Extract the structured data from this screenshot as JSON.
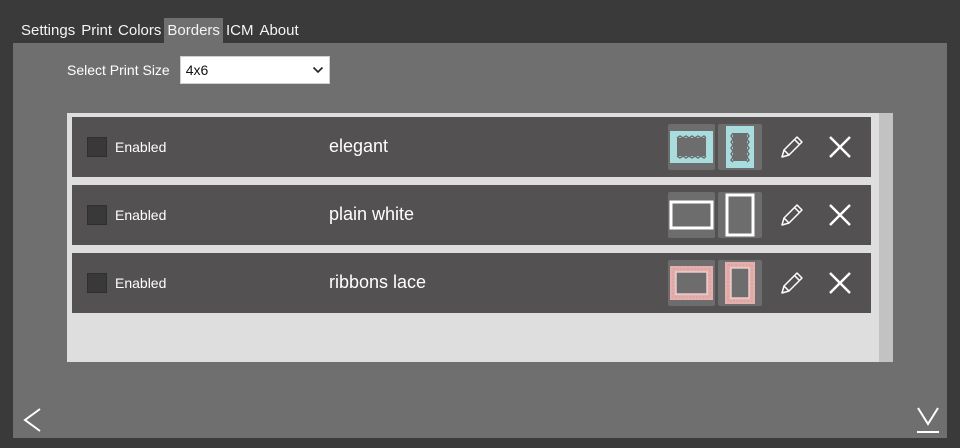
{
  "tabs": [
    {
      "label": "Settings",
      "active": false
    },
    {
      "label": "Print",
      "active": false
    },
    {
      "label": "Colors",
      "active": false
    },
    {
      "label": "Borders",
      "active": true
    },
    {
      "label": "ICM",
      "active": false
    },
    {
      "label": "About",
      "active": false
    }
  ],
  "print_size": {
    "label": "Select Print Size",
    "value": "4x6"
  },
  "borders": [
    {
      "enabled_label": "Enabled",
      "enabled": false,
      "name": "elegant",
      "style": "elegant",
      "color": "#a9dcdd"
    },
    {
      "enabled_label": "Enabled",
      "enabled": false,
      "name": "plain white",
      "style": "plain",
      "color": "#ffffff"
    },
    {
      "enabled_label": "Enabled",
      "enabled": false,
      "name": "ribbons lace",
      "style": "lace",
      "color": "#e3b0ae"
    }
  ],
  "icons": {
    "edit": "pencil-icon",
    "delete": "close-icon",
    "back": "chevron-left-icon",
    "download": "download-icon",
    "dropdown": "chevron-down-icon"
  }
}
